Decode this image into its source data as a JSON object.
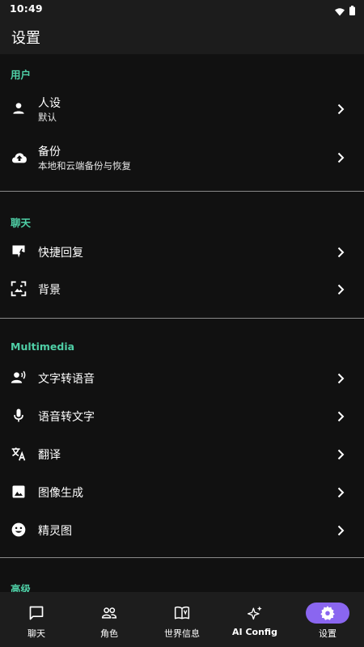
{
  "status": {
    "time": "10:49"
  },
  "appbar": {
    "title": "设置"
  },
  "sections": {
    "user": {
      "header": "用户",
      "persona": {
        "label": "人设",
        "sublabel": "默认"
      },
      "backup": {
        "label": "备份",
        "sublabel": "本地和云端备份与恢复"
      }
    },
    "chat": {
      "header": "聊天",
      "quick_reply": {
        "label": "快捷回复"
      },
      "background": {
        "label": "背景"
      }
    },
    "multimedia": {
      "header": "Multimedia",
      "tts": {
        "label": "文字转语音"
      },
      "stt": {
        "label": "语音转文字"
      },
      "translate": {
        "label": "翻译"
      },
      "image_gen": {
        "label": "图像生成"
      },
      "sprites": {
        "label": "精灵图"
      }
    },
    "advanced": {
      "header": "高级"
    }
  },
  "bottom_nav": {
    "chat": "聊天",
    "characters": "角色",
    "world_info": "世界信息",
    "ai_config": "AI Config",
    "settings": "设置"
  },
  "colors": {
    "accent": "#4fcfa6",
    "active_pill": "#8a66f0",
    "background": "#111111",
    "bar": "#1c1c1c"
  }
}
